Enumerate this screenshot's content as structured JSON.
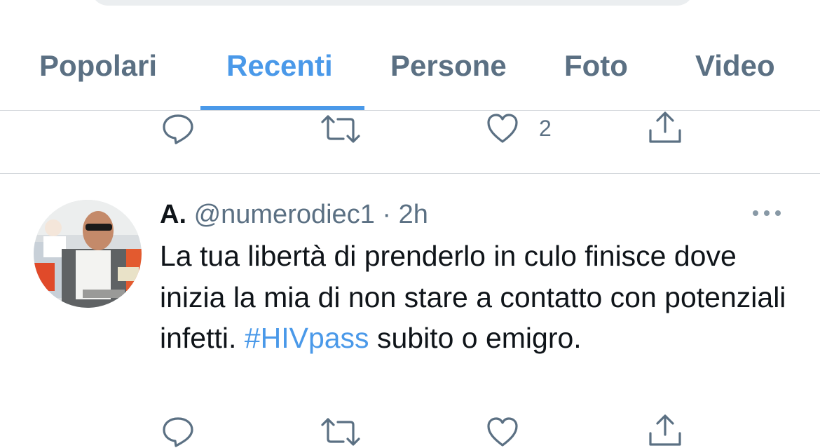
{
  "tabs": [
    {
      "label": "Popolari"
    },
    {
      "label": "Recenti"
    },
    {
      "label": "Persone"
    },
    {
      "label": "Foto"
    },
    {
      "label": "Video"
    }
  ],
  "active_tab": "Recenti",
  "previous_tweet": {
    "like_count": "2"
  },
  "tweet": {
    "display_name": "A.",
    "handle": "@numerodiec1",
    "separator": "·",
    "time": "2h",
    "text_before": "La tua libertà di prenderlo in culo finisce dove inizia la mia di non stare a contatto con potenziali infetti.",
    "hashtag": "#HIVpass",
    "text_after": "subito o emigro."
  },
  "icons": {
    "reply": "reply-icon",
    "retweet": "retweet-icon",
    "like": "heart-icon",
    "share": "share-icon",
    "more": "more-icon"
  },
  "colors": {
    "accent": "#4a99e9",
    "secondary_text": "#5b7083",
    "primary_text": "#0f1419",
    "divider": "#d4d8dc"
  }
}
